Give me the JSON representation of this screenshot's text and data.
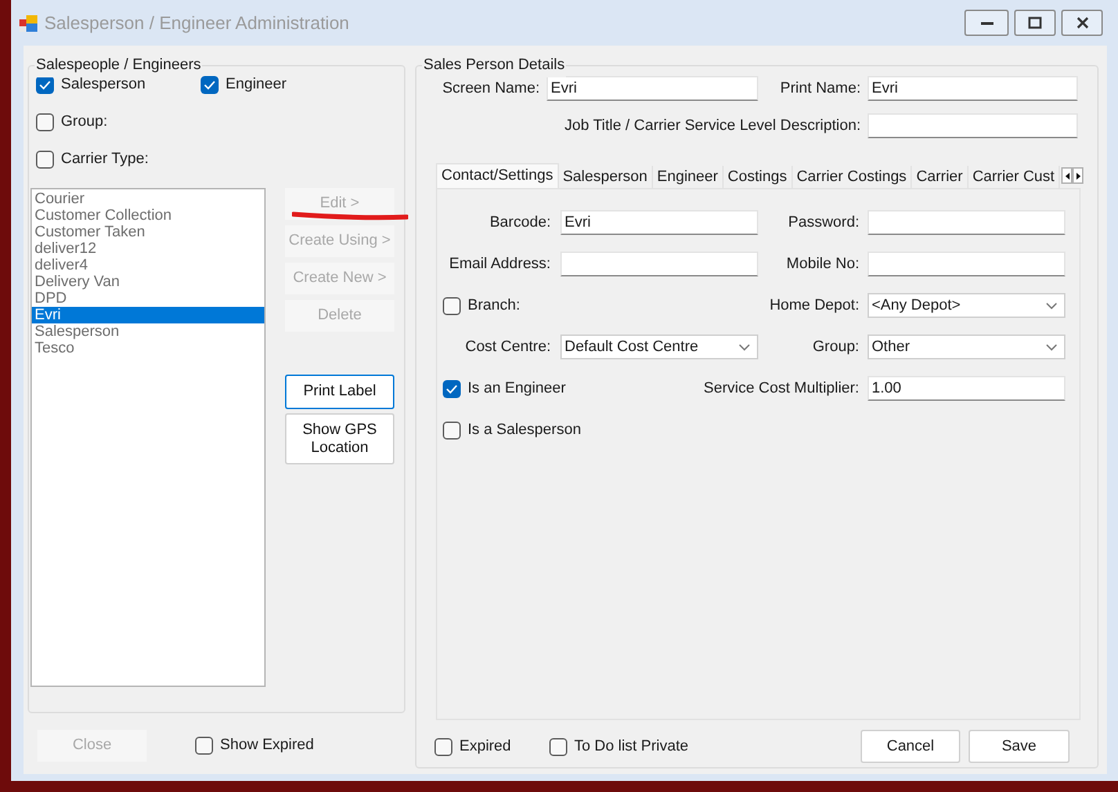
{
  "window": {
    "title": "Salesperson / Engineer Administration"
  },
  "filter": {
    "title": "Salespeople / Engineers",
    "options": [
      {
        "label": "Salesperson",
        "checked": true
      },
      {
        "label": "Engineer",
        "checked": true
      },
      {
        "label": "Group:",
        "checked": false
      },
      {
        "label": "Carrier Type:",
        "checked": false
      }
    ]
  },
  "list": {
    "items": [
      {
        "label": "Courier",
        "selected": false
      },
      {
        "label": "Customer Collection",
        "selected": false
      },
      {
        "label": "Customer Taken",
        "selected": false
      },
      {
        "label": "deliver12",
        "selected": false
      },
      {
        "label": "deliver4",
        "selected": false
      },
      {
        "label": "Delivery Van",
        "selected": false
      },
      {
        "label": "DPD",
        "selected": false
      },
      {
        "label": "Evri",
        "selected": true
      },
      {
        "label": "Salesperson",
        "selected": false
      },
      {
        "label": "Tesco",
        "selected": false
      }
    ]
  },
  "actions": [
    {
      "label": "Edit >",
      "disabled": true,
      "focused": false
    },
    {
      "label": "Create Using >",
      "disabled": true,
      "focused": false
    },
    {
      "label": "Create New >",
      "disabled": true,
      "focused": false
    },
    {
      "label": "Delete",
      "disabled": true,
      "focused": false
    },
    {
      "label": "Print Label",
      "disabled": false,
      "focused": true
    },
    {
      "label": "Show GPS Location",
      "disabled": false,
      "focused": false
    }
  ],
  "close_button": {
    "label": "Close",
    "disabled": true
  },
  "show_expired": {
    "label": "Show Expired",
    "checked": false
  },
  "details": {
    "title": "Sales Person Details",
    "screen_name": {
      "label": "Screen Name:",
      "value": "Evri"
    },
    "print_name": {
      "label": "Print Name:",
      "value": "Evri"
    },
    "job_title": {
      "label": "Job Title / Carrier Service Level Description:"
    }
  },
  "tabs": [
    {
      "label": "Contact/Settings",
      "selected": true
    },
    {
      "label": "Salesperson",
      "selected": false
    },
    {
      "label": "Engineer",
      "selected": false
    },
    {
      "label": "Costings",
      "selected": false
    },
    {
      "label": "Carrier Costings",
      "selected": false
    },
    {
      "label": "Carrier",
      "selected": false
    },
    {
      "label": "Carrier Cust",
      "selected": false
    }
  ],
  "tab_rows": [
    {
      "left": {
        "kind": "field",
        "label": "Barcode:",
        "value": "Evri"
      },
      "right": {
        "kind": "field",
        "label": "Password:"
      }
    },
    {
      "left": {
        "kind": "field",
        "label": "Email Address:"
      },
      "right": {
        "kind": "field",
        "label": "Mobile No:"
      }
    },
    {
      "left": {
        "kind": "checkbox",
        "label": "Branch:",
        "checked": false
      },
      "right": {
        "kind": "select",
        "label": "Home Depot:",
        "value": "<Any Depot>"
      }
    },
    {
      "left": {
        "kind": "select",
        "label": "Cost Centre:",
        "value": "Default Cost Centre"
      },
      "right": {
        "kind": "select",
        "label": "Group:",
        "value": "Other"
      }
    },
    {
      "left": {
        "kind": "checkbox",
        "label": "Is an Engineer",
        "checked": true
      },
      "right": {
        "kind": "field",
        "label": "Service Cost Multiplier:",
        "value": "1.00"
      }
    },
    {
      "left": {
        "kind": "checkbox",
        "label": "Is a Salesperson",
        "checked": false
      }
    }
  ],
  "bottom_options": [
    {
      "label": "Expired",
      "checked": false
    },
    {
      "label": "To Do list Private",
      "checked": false
    }
  ],
  "buttons": [
    {
      "label": "Cancel"
    },
    {
      "label": "Save"
    }
  ]
}
